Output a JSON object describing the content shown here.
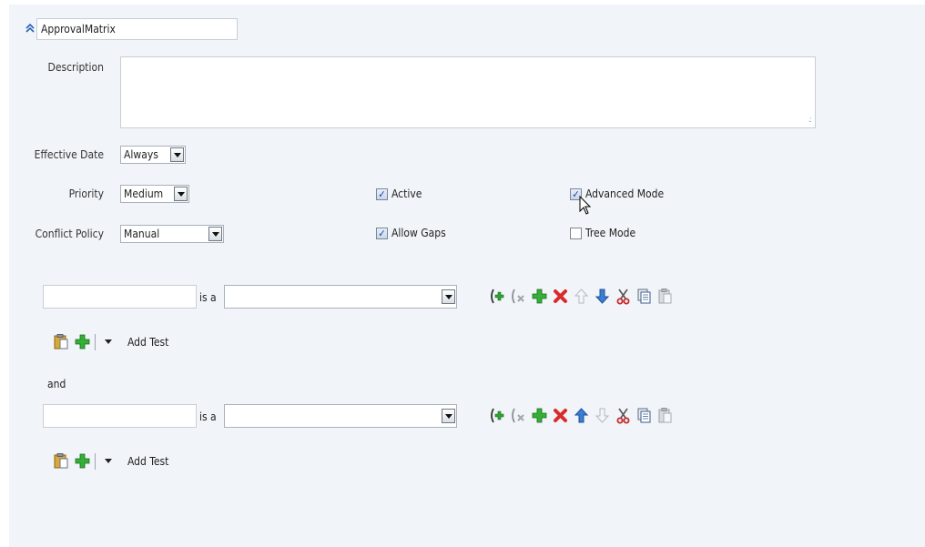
{
  "rule": {
    "name_value": "ApprovalMatrix",
    "description_label": "Description",
    "description_value": ""
  },
  "fields": {
    "effective_date": {
      "label": "Effective Date",
      "value": "Always"
    },
    "priority": {
      "label": "Priority",
      "value": "Medium"
    },
    "conflict_policy": {
      "label": "Conflict Policy",
      "value": "Manual"
    }
  },
  "checkboxes": {
    "active": {
      "label": "Active",
      "checked": true
    },
    "allow_gaps": {
      "label": "Allow Gaps",
      "checked": true
    },
    "advanced_mode": {
      "label": "Advanced Mode",
      "checked": true
    },
    "tree_mode": {
      "label": "Tree Mode",
      "checked": false
    }
  },
  "tests": [
    {
      "left_value": "",
      "operator": "is a",
      "type_value": "",
      "add_test_label": "Add Test"
    },
    {
      "left_value": "",
      "operator": "is a",
      "type_value": "",
      "add_test_label": "Add Test"
    }
  ],
  "connector": "and",
  "icons": {
    "row_toolbar": [
      "add-parentheses-icon",
      "remove-parentheses-icon",
      "add-icon",
      "delete-icon",
      "move-up-icon",
      "move-down-icon",
      "cut-icon",
      "copy-icon",
      "paste-icon"
    ],
    "test_toolbar": [
      "paste-icon",
      "add-icon",
      "dropdown-icon"
    ]
  },
  "colors": {
    "panel_bg": "#f1f4f8",
    "accent_blue": "#2a63b5",
    "add_green": "#2fa32f",
    "delete_red": "#d92b2b"
  }
}
